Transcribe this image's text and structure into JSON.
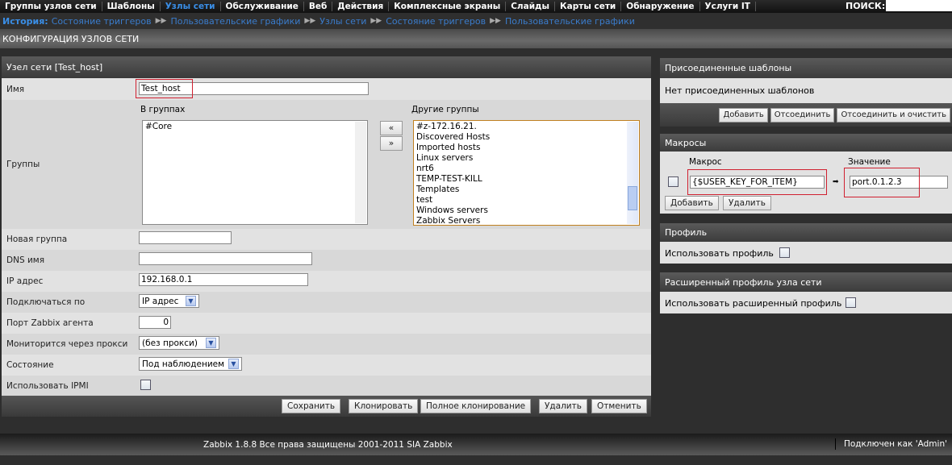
{
  "nav": {
    "items": [
      "Группы узлов сети",
      "Шаблоны",
      "Узлы сети",
      "Обслуживание",
      "Веб",
      "Действия",
      "Комплексные экраны",
      "Слайды",
      "Карты сети",
      "Обнаружение",
      "Услуги IT"
    ],
    "active": "Узлы сети",
    "search_label": "ПОИСК:",
    "search_value": ""
  },
  "breadcrumb": {
    "label": "История:",
    "items": [
      "Состояние триггеров",
      "Пользовательские графики",
      "Узлы сети",
      "Состояние триггеров",
      "Пользовательские графики"
    ]
  },
  "page_title": "КОНФИГУРАЦИЯ УЗЛОВ СЕТИ",
  "host_form": {
    "title": "Узел сети  [Test_host]",
    "name_label": "Имя",
    "name_value": "Test_host",
    "groups_label": "Группы",
    "in_groups_label": "В группах",
    "in_groups": [
      "#Core"
    ],
    "other_groups_label": "Другие группы",
    "other_groups": [
      "#z-172.16.21.",
      "Discovered Hosts",
      "Imported hosts",
      "Linux servers",
      "nrt6",
      "TEMP-TEST-KILL",
      "Templates",
      "test",
      "Windows servers",
      "Zabbix Servers"
    ],
    "move_left": "«",
    "move_right": "»",
    "new_group_label": "Новая группа",
    "new_group_value": "",
    "dns_label": "DNS имя",
    "dns_value": "",
    "ip_label": "IP адрес",
    "ip_value": "192.168.0.1",
    "connect_label": "Подключаться по",
    "connect_value": "IP адрес",
    "port_label": "Порт Zabbix агента",
    "port_value": "0",
    "proxy_label": "Мониторится через прокси",
    "proxy_value": "(без прокси)",
    "status_label": "Состояние",
    "status_value": "Под наблюдением",
    "ipmi_label": "Использовать IPMI",
    "ipmi_checked": false,
    "buttons": [
      "Сохранить",
      "Клонировать",
      "Полное клонирование",
      "Удалить",
      "Отменить"
    ]
  },
  "templates": {
    "title": "Присоединенные шаблоны",
    "empty": "Нет присоединенных шаблонов",
    "buttons": [
      "Добавить",
      "Отсоединить",
      "Отсоединить и очистить"
    ]
  },
  "macros": {
    "title": "Макросы",
    "macro_col": "Макрос",
    "value_col": "Значение",
    "macro_value": "{$USER_KEY_FOR_ITEM}",
    "arrow": "➡",
    "value_value": "port.0.1.2.3",
    "add": "Добавить",
    "remove": "Удалить"
  },
  "profile": {
    "title": "Профиль",
    "use_label": "Использовать профиль"
  },
  "ext_profile": {
    "title": "Расширенный профиль узла сети",
    "use_label": "Использовать расширенный профиль"
  },
  "footer": {
    "copyright": "Zabbix 1.8.8 Все права защищены 2001-2011 SIA Zabbix",
    "connected": "Подключен как 'Admin'"
  },
  "colors": {
    "accent": "#3a8ee6",
    "highlight_box": "#d02030"
  }
}
